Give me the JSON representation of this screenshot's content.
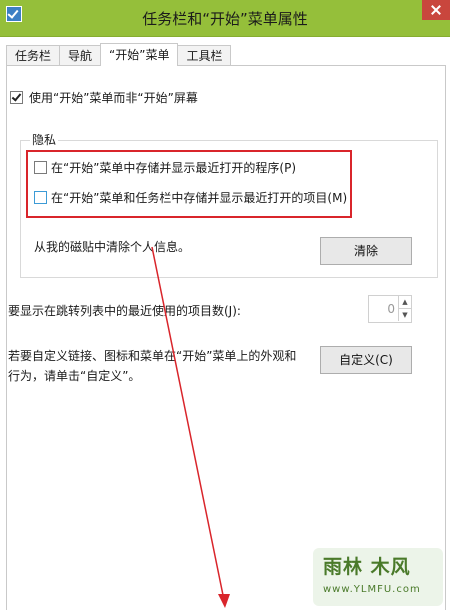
{
  "window": {
    "title": "任务栏和“开始”菜单属性"
  },
  "tabs": [
    {
      "label": "任务栏"
    },
    {
      "label": "导航"
    },
    {
      "label": "“开始”菜单"
    },
    {
      "label": "工具栏"
    }
  ],
  "start_menu": {
    "use_start_label": "使用“开始”菜单而非“开始”屏幕",
    "use_start_checked": true
  },
  "privacy": {
    "group_title": "隐私",
    "store_programs_label": "在“开始”菜单中存储并显示最近打开的程序(P)",
    "store_programs_checked": false,
    "store_items_label": "在“开始”菜单和任务栏中存储并显示最近打开的项目(M)",
    "store_items_checked": false,
    "clear_text": "从我的磁贴中清除个人信息。",
    "clear_button": "清除"
  },
  "jump_list": {
    "label": "要显示在跳转列表中的最近使用的项目数(J):",
    "value": "0",
    "up_glyph": "▲",
    "down_glyph": "▼"
  },
  "customize": {
    "text": "若要自定义链接、图标和菜单在“开始”菜单上的外观和行为，请单击“自定义”。",
    "button": "自定义(C)"
  },
  "watermark": {
    "top": "雨林 木风",
    "bottom": "www.YLMFU.com"
  },
  "colors": {
    "titlebar": "#95bf3a",
    "close_button": "#c9463d",
    "highlight": "#d9252b"
  }
}
